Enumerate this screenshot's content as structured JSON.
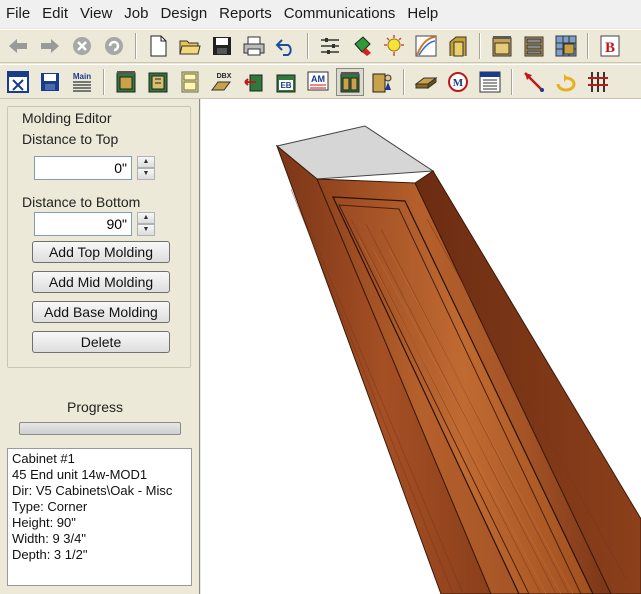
{
  "menu": [
    "File",
    "Edit",
    "View",
    "Job",
    "Design",
    "Reports",
    "Communications",
    "Help"
  ],
  "toolbar1": {
    "icons": [
      "back-arrow-icon",
      "forward-arrow-icon",
      "stop-icon",
      "refresh-icon",
      "new-document-icon",
      "open-folder-icon",
      "save-disk-icon",
      "print-icon",
      "undo-icon",
      "settings-sliders-icon",
      "paint-bucket-icon",
      "light-bulb-icon",
      "curve-icon",
      "door-frame-icon",
      "cabinet-icon",
      "cabinet-drawers-icon",
      "grid-cabinet-icon",
      "bold-b-icon"
    ],
    "bold_label": "B"
  },
  "toolbar2": {
    "icons": [
      "close-window-icon",
      "save-icon",
      "main-icon",
      "cabinet-green-icon",
      "cabinet-open-icon",
      "yellow-cabinet-icon",
      "dbx-icon",
      "arrows-cabinet-icon",
      "eb-icon",
      "am-icon",
      "cabinet-selected-icon",
      "cabinet-person-icon",
      "board-icon",
      "cm-icon",
      "con-window-icon",
      "pointer-arrow-icon",
      "rotate-icon",
      "fence-icon"
    ],
    "main_label": "Main",
    "dbx_label": "DBX",
    "eb_label": "EB",
    "am_label": "AM",
    "cm_label": "M"
  },
  "molding_editor": {
    "title": "Molding Editor",
    "distance_top_label": "Distance to Top",
    "distance_top_value": "0\"",
    "distance_bottom_label": "Distance to Bottom",
    "distance_bottom_value": "90\"",
    "add_top_label": "Add Top Molding",
    "add_mid_label": "Add Mid Molding",
    "add_base_label": "Add Base Molding",
    "delete_label": "Delete"
  },
  "progress": {
    "label": "Progress",
    "value": 0
  },
  "info": {
    "lines": [
      "Cabinet #1",
      "45 End unit 14w-MOD1",
      "Dir: V5 Cabinets\\Oak - Misc",
      "Type: Corner",
      "Height: 90\"",
      "Width: 9 3/4\"",
      "Depth: 3 1/2\""
    ]
  },
  "colors": {
    "wood_dark": "#6e2f14",
    "wood_mid": "#9c4a22",
    "wood_light": "#b8622e",
    "top_face": "#d6d6d6"
  }
}
